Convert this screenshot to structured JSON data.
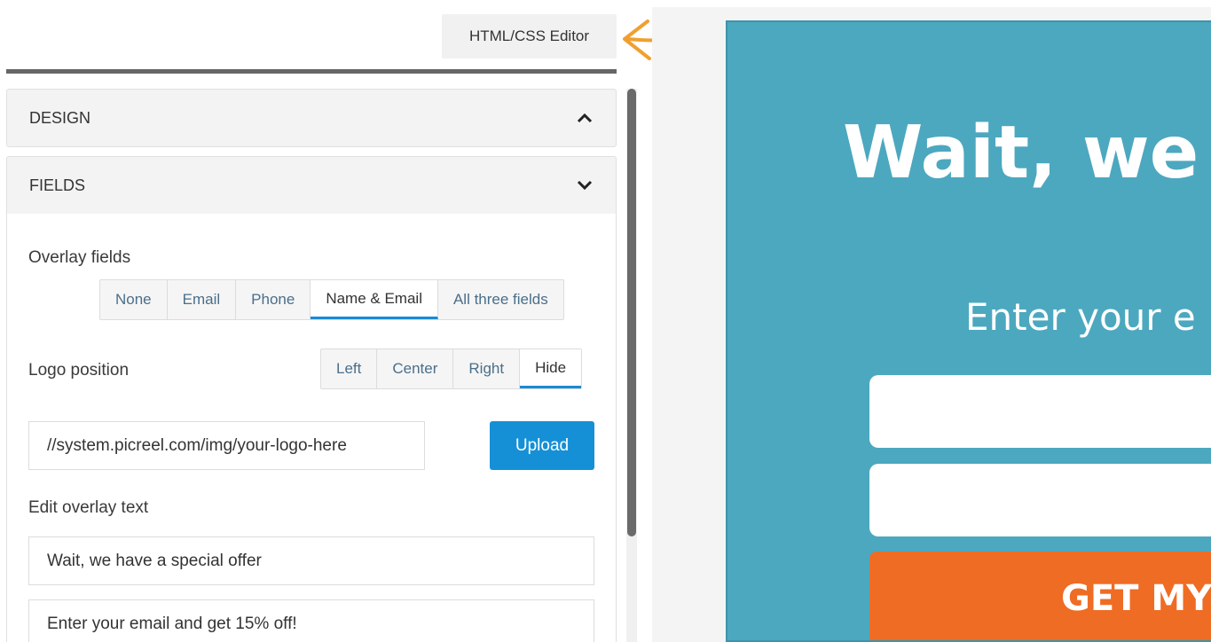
{
  "toolbar": {
    "editor_label": "HTML/CSS Editor"
  },
  "accordion": {
    "design_label": "DESIGN",
    "fields_label": "FIELDS"
  },
  "overlay_fields": {
    "label": "Overlay fields",
    "options": [
      "None",
      "Email",
      "Phone",
      "Name & Email",
      "All three fields"
    ],
    "selected": "Name & Email"
  },
  "logo_position": {
    "label": "Logo position",
    "options": [
      "Left",
      "Center",
      "Right",
      "Hide"
    ],
    "selected": "Hide"
  },
  "logo_url": {
    "value": "//system.picreel.com/img/your-logo-here",
    "upload_label": "Upload"
  },
  "overlay_text": {
    "label": "Edit overlay text",
    "headline": "Wait, we have a special offer",
    "subline": "Enter your email and get 15% off!"
  },
  "preview": {
    "headline": "Wait, we",
    "subline": "Enter your e",
    "button_label": "GET MY"
  },
  "colors": {
    "overlay_bg": "#4ca8bf",
    "cta_button": "#ef6c24",
    "accent_blue": "#1590d6",
    "arrow": "#f0a030"
  }
}
